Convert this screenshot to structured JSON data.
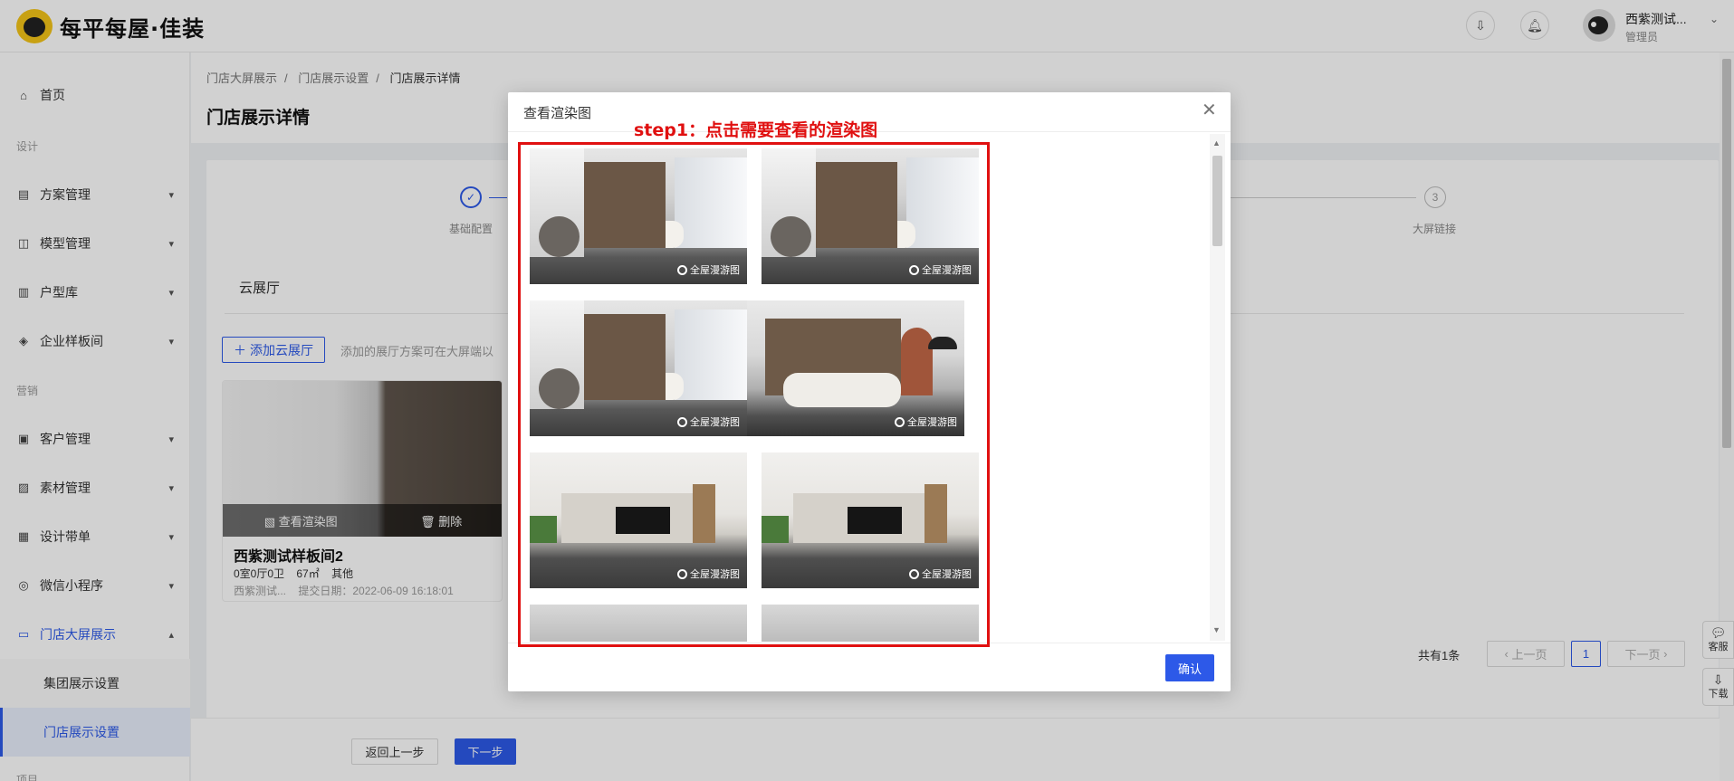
{
  "brand": {
    "name": "每平每屋·佳装"
  },
  "header": {
    "user_name": "西紫测试...",
    "user_role": "管理员",
    "icons": [
      "download-box-icon",
      "bell-icon"
    ]
  },
  "sidebar": {
    "home": "首页",
    "group_design": "设计",
    "items_design": [
      "方案管理",
      "模型管理",
      "户型库",
      "企业样板间"
    ],
    "group_marketing": "营销",
    "items_marketing": [
      "客户管理",
      "素材管理",
      "设计带单",
      "微信小程序",
      "门店大屏展示"
    ],
    "sub_items": [
      "集团展示设置",
      "门店展示设置"
    ],
    "group_project": "项目"
  },
  "breadcrumb": [
    "门店大屏展示",
    "门店展示设置",
    "门店展示详情"
  ],
  "page_title": "门店展示详情",
  "steps": {
    "labels": [
      "基础配置",
      "大屏链接"
    ],
    "step3_number": "3"
  },
  "tab": {
    "label": "云展厅"
  },
  "add_button": {
    "label": "添加云展厅"
  },
  "add_hint": "添加的展厅方案可在大屏端以",
  "hall_card": {
    "view_label": "查看渲染图",
    "delete_label": "删除",
    "name": "西紫测试样板间2",
    "layout": "0室0厅0卫",
    "area": "67㎡",
    "type": "其他",
    "author": "西紫测试...",
    "date": "提交日期：2022-06-09 16:18:01"
  },
  "pagination": {
    "total": "共有1条",
    "prev": "上一页",
    "page": "1",
    "next": "下一页"
  },
  "footer": {
    "back": "返回上一步",
    "next": "下一步"
  },
  "float_buttons": {
    "service": "客服",
    "download": "下载"
  },
  "modal": {
    "title": "查看渲染图",
    "annotation": "step1：点击需要查看的渲染图",
    "thumb_badge": "全屋漫游图",
    "confirm": "确认"
  },
  "colors": {
    "primary": "#2d59e8",
    "annotation_red": "#e01010"
  }
}
